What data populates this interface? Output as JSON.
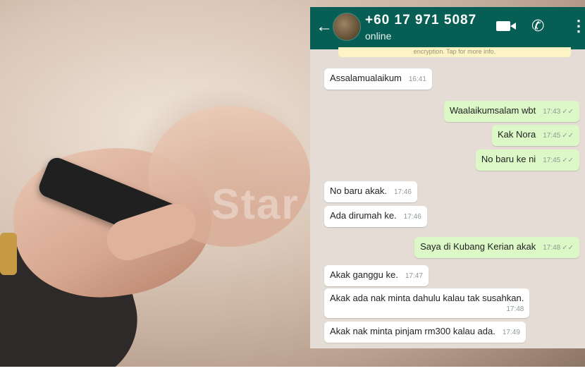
{
  "photo": {
    "watermark": "Star"
  },
  "chat": {
    "header": {
      "back_icon": "arrow-left-icon",
      "contact_name": "+60 17 971 5087",
      "status": "online",
      "video_icon": "video-call-icon",
      "call_icon": "phone-icon",
      "menu_icon": "more-vertical-icon",
      "back_glyph": "←",
      "call_glyph": "✆",
      "menu_glyph": "⋮"
    },
    "encryption_notice": "encryption. Tap for more info.",
    "messages": [
      {
        "direction": "in",
        "text": "Assalamualaikum",
        "time": "16:41"
      },
      {
        "direction": "out",
        "text": "Waalaikumsalam wbt",
        "time": "17:43",
        "ticks": "✓✓"
      },
      {
        "direction": "out",
        "text": "Kak Nora",
        "time": "17:45",
        "ticks": "✓✓"
      },
      {
        "direction": "out",
        "text": "No baru ke ni",
        "time": "17:45",
        "ticks": "✓✓"
      },
      {
        "direction": "in",
        "text": "No baru akak.",
        "time": "17:46"
      },
      {
        "direction": "in",
        "text": "Ada dirumah ke.",
        "time": "17:46"
      },
      {
        "direction": "out",
        "text": "Saya di Kubang Kerian akak",
        "time": "17:48",
        "ticks": "✓✓"
      },
      {
        "direction": "in",
        "text": "Akak ganggu ke.",
        "time": "17:47"
      },
      {
        "direction": "in",
        "text": "Akak ada nak minta dahulu kalau tak susahkan.",
        "time": "17:48"
      },
      {
        "direction": "in",
        "text": "Akak nak minta pinjam rm300 kalau ada.",
        "time": "17:49"
      }
    ],
    "colors": {
      "header": "#075e54",
      "background": "#e5ddd5",
      "incoming": "#ffffff",
      "outgoing": "#dcf8c6"
    }
  }
}
